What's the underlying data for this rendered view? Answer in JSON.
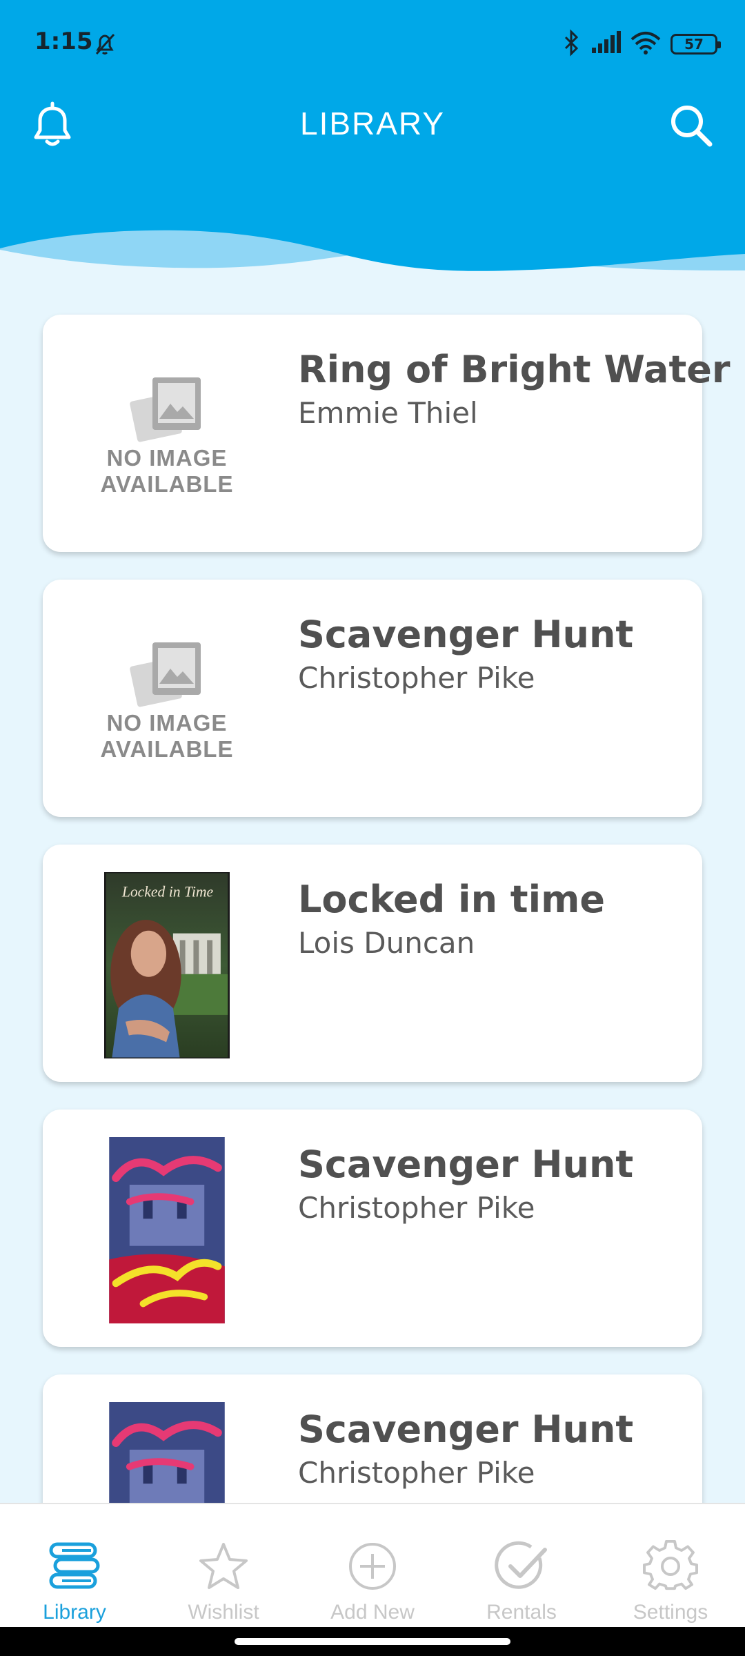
{
  "status_bar": {
    "time": "1:15",
    "battery": "57"
  },
  "header": {
    "title": "LIBRARY"
  },
  "books": [
    {
      "title": "Ring of Bright Water",
      "author": "Emmie Thiel",
      "cover": "none",
      "no_image_line1": "NO IMAGE",
      "no_image_line2": "AVAILABLE"
    },
    {
      "title": "Scavenger Hunt",
      "author": "Christopher Pike",
      "cover": "none",
      "no_image_line1": "NO IMAGE",
      "no_image_line2": "AVAILABLE"
    },
    {
      "title": "Locked in time",
      "author": "Lois Duncan",
      "cover": "locked-in-time-cover",
      "cover_text": "Locked in Time"
    },
    {
      "title": "Scavenger Hunt",
      "author": "Christopher Pike",
      "cover": "scavenger-hunt-cover"
    },
    {
      "title": "Scavenger Hunt",
      "author": "Christopher Pike",
      "cover": "scavenger-hunt-cover"
    }
  ],
  "nav": [
    {
      "label": "Library",
      "icon": "library-icon",
      "active": true
    },
    {
      "label": "Wishlist",
      "icon": "star-icon",
      "active": false
    },
    {
      "label": "Add New",
      "icon": "add-circle-icon",
      "active": false
    },
    {
      "label": "Rentals",
      "icon": "check-circle-icon",
      "active": false
    },
    {
      "label": "Settings",
      "icon": "gear-icon",
      "active": false
    }
  ],
  "colors": {
    "accent": "#00a8e8",
    "background": "#e7f6fd",
    "nav_active": "#1aa0dc",
    "nav_inactive": "#c7c7c7"
  }
}
